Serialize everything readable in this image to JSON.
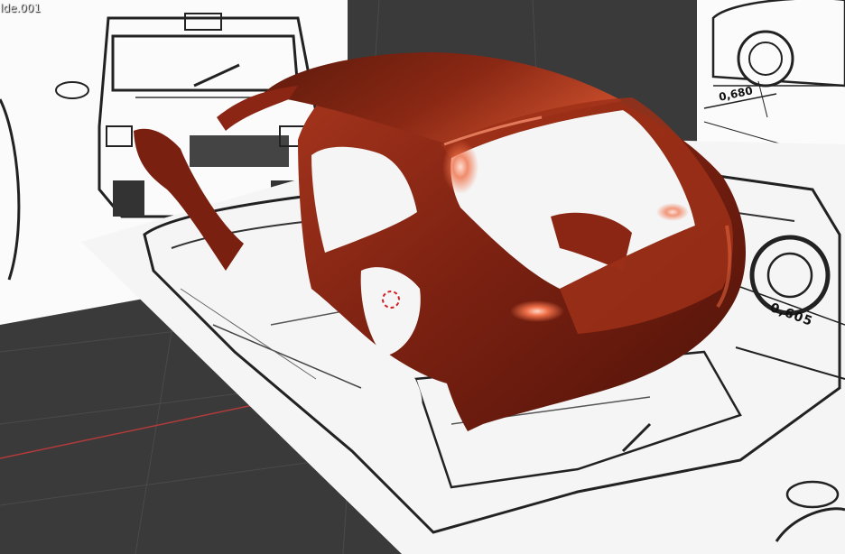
{
  "viewport": {
    "object_name": "lde.001",
    "background_color": "#3a3a3a",
    "grid_color": "#4a4a4a",
    "x_axis_color": "#b33a3a",
    "y_axis_color": "#6e9a3a",
    "body_color": "#8b2514",
    "highlight_color": "#f07048"
  },
  "blueprints": {
    "front_dimension": "0,680",
    "rear_dimension": "0,605"
  },
  "objects": {
    "car_body_mesh": "car-body-shell",
    "cursor": "3d-cursor"
  }
}
